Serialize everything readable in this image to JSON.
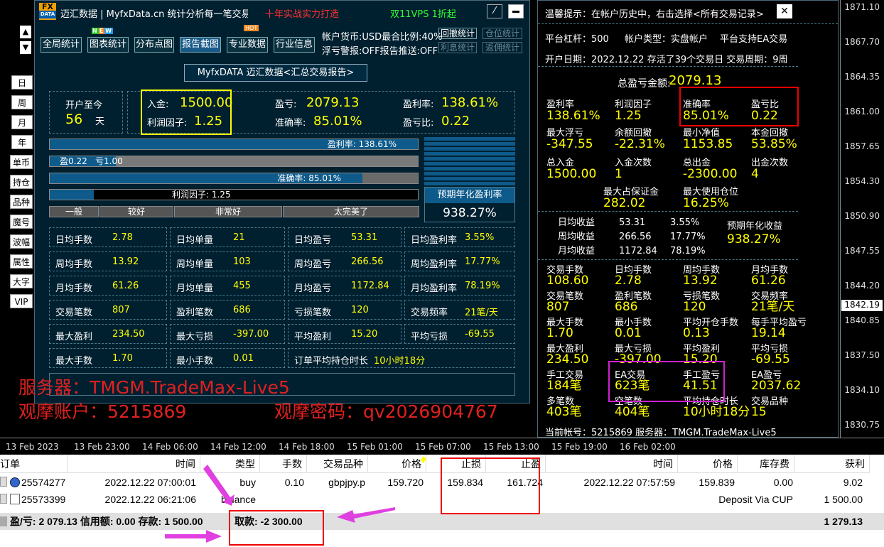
{
  "price_axis": {
    "ticks": [
      "1871.10",
      "1867.70",
      "1864.35",
      "1861.00",
      "1857.65",
      "1854.30",
      "1850.90",
      "1847.55",
      "1844.20",
      "1840.85",
      "1837.50",
      "1834.10",
      "1830.75"
    ],
    "current": "1842.19"
  },
  "time_axis": [
    "13 Feb 2023",
    "13 Feb 23:00",
    "14 Feb 06:00",
    "14 Feb 12:00",
    "14 Feb 18:00",
    "15 Feb 01:00",
    "15 Feb 07:00",
    "15 Feb 13:00",
    "15 Feb 19:00",
    "16 Feb 02:00"
  ],
  "header": {
    "logo_top": "FX",
    "logo_bottom": "DATA",
    "title": "迈汇数据 | MyfxData.cn  统计分析每一笔交易",
    "slogan": "十年实战实力打造",
    "promo": "双11VPS 1折起"
  },
  "toolbar": {
    "buttons": [
      "全局统计",
      "图表统计",
      "分布点图",
      "报告截图",
      "专业数据",
      "行业信息"
    ],
    "info1": "帐户货币:USD最合比例:40%",
    "info2": "浮亏警报:OFF报告推送:OFF",
    "links": [
      "回撤统计",
      "仓位统计",
      "利息统计",
      "返佣统计"
    ],
    "new_badge": "NEW",
    "hot_badge": "HOT"
  },
  "side_buttons": [
    "日",
    "周",
    "月",
    "年",
    "单币",
    "持仓",
    "品种",
    "魔号",
    "波幅",
    "属性",
    "大字",
    "VIP"
  ],
  "report_title": "MyfxDATA 迈汇数据<汇总交易报告>",
  "summary": {
    "since_label": "开户至今",
    "days": "56",
    "days_unit": "天",
    "deposit_label": "入金:",
    "deposit": "1500.00",
    "pf_label": "利润因子:",
    "pf": "1.25",
    "profit_label": "盈亏:",
    "profit": "2079.13",
    "accuracy_label": "准确率:",
    "accuracy": "85.01%",
    "rate_label": "盈利率:",
    "rate": "138.61%",
    "ratio_label": "盈亏比:",
    "ratio": "0.22"
  },
  "bars": {
    "rate": {
      "label": "盈利率: 138.61%",
      "fill": 1.0
    },
    "ratio": {
      "win": "盈0.22",
      "loss": "亏1.00",
      "fill": 0.18
    },
    "accuracy": {
      "label": "准确率:  85.01%",
      "fill": 0.85
    },
    "pf": {
      "label": "利润因子:  1.25",
      "fill": 0.12
    },
    "scale": [
      "一般",
      "较好",
      "非常好",
      "太完美了"
    ]
  },
  "annual": {
    "label": "预期年化盈利率",
    "value": "938.27%"
  },
  "grid": [
    [
      [
        "日均手数",
        "2.78"
      ],
      [
        "日均单量",
        "21"
      ],
      [
        "日均盈亏",
        "53.31"
      ],
      [
        "日均盈利率",
        "3.55%"
      ]
    ],
    [
      [
        "周均手数",
        "13.92"
      ],
      [
        "周均单量",
        "103"
      ],
      [
        "周均盈亏",
        "266.56"
      ],
      [
        "周均盈利率",
        "17.77%"
      ]
    ],
    [
      [
        "月均手数",
        "61.26"
      ],
      [
        "月均单量",
        "455"
      ],
      [
        "月均盈亏",
        "1172.84"
      ],
      [
        "月均盈利率",
        "78.19%"
      ]
    ],
    [
      [
        "交易笔数",
        "807"
      ],
      [
        "盈利笔数",
        "686"
      ],
      [
        "亏损笔数",
        "120"
      ],
      [
        "交易频率",
        "21笔/天"
      ]
    ],
    [
      [
        "最大盈利",
        "234.50"
      ],
      [
        "最大亏损",
        "-397.00"
      ],
      [
        "平均盈利",
        "15.20"
      ],
      [
        "平均亏损",
        "-69.55"
      ]
    ]
  ],
  "last_row": {
    "k1": "最大手数",
    "v1": "1.70",
    "k2": "最小手数",
    "v2": "0.01",
    "k3": "订单平均持仓时长",
    "v3": "10小时18分"
  },
  "overlay": {
    "server": "服务器：TMGM.TradeMax-Live5",
    "account": "观摩账户：5215869",
    "password": "观摩密码：qv2026904767"
  },
  "right": {
    "notice": "温馨提示：在帐户历史中，右击选择<所有交易记录>",
    "close": "✕",
    "leverage": "平台杠杆：500",
    "acct_type": "帐户类型：实盘帐户",
    "ea_support": "平台支持EA交易",
    "open_date": "开户日期：2022.12.22 存活了39个交易日 交易周期：9周",
    "total_label": "总盈亏金额:",
    "total": "2079.13",
    "stats": [
      [
        [
          "盈利率",
          "138.61%"
        ],
        [
          "利润因子",
          "1.25"
        ],
        [
          "准确率",
          "85.01%"
        ],
        [
          "盈亏比",
          "0.22"
        ]
      ],
      [
        [
          "最大浮亏",
          "-347.55"
        ],
        [
          "余额回撤",
          "-22.31%"
        ],
        [
          "最小净值",
          "1153.85"
        ],
        [
          "本金回撤",
          "53.85%"
        ]
      ],
      [
        [
          "总入金",
          "1500.00"
        ],
        [
          "入金次数",
          "1"
        ],
        [
          "总出金",
          "-2300.00"
        ],
        [
          "出金次数",
          "4"
        ]
      ]
    ],
    "margin_row": [
      [
        "最大占保证金",
        "282.02"
      ],
      [
        "最大使用仓位",
        "16.25%"
      ]
    ],
    "income": [
      [
        "日均收益",
        "53.31",
        "3.55%"
      ],
      [
        "周均收益",
        "266.56",
        "17.77%"
      ],
      [
        "月均收益",
        "1172.84",
        "78.19%"
      ]
    ],
    "annual_label": "预期年化收益",
    "annual_value": "938.27%",
    "stats2": [
      [
        [
          "交易手数",
          "108.60"
        ],
        [
          "日均手数",
          "2.78"
        ],
        [
          "周均手数",
          "13.92"
        ],
        [
          "月均手数",
          "61.26"
        ]
      ],
      [
        [
          "交易笔数",
          "807"
        ],
        [
          "盈利笔数",
          "686"
        ],
        [
          "亏损笔数",
          "120"
        ],
        [
          "交易频率",
          "21笔/天"
        ]
      ],
      [
        [
          "最大手数",
          "1.70"
        ],
        [
          "最小手数",
          "0.01"
        ],
        [
          "平均开仓手数",
          "0.13"
        ],
        [
          "每手平均盈亏",
          "19.14"
        ]
      ],
      [
        [
          "最大盈利",
          "234.50"
        ],
        [
          "最大亏损",
          "-397.00"
        ],
        [
          "平均盈利",
          "15.20"
        ],
        [
          "平均亏损",
          "-69.55"
        ]
      ],
      [
        [
          "手工交易",
          "184笔"
        ],
        [
          "EA交易",
          "623笔"
        ],
        [
          "手工盈亏",
          "41.51"
        ],
        [
          "EA盈亏",
          "2037.62"
        ]
      ],
      [
        [
          "多笔数",
          "403笔"
        ],
        [
          "空笔数",
          "404笔"
        ],
        [
          "平均持仓时长",
          "10小时18分"
        ],
        [
          "交易品种",
          "15"
        ]
      ]
    ],
    "footer": "当前帐号：5215869 服务器：TMGM.TradeMax-Live5"
  },
  "table": {
    "headers": [
      "订单",
      "时间",
      "类型",
      "手数",
      "交易品种",
      "价格",
      "止损",
      "止盈",
      "时间",
      "价格",
      "库存费",
      "获利"
    ],
    "sort_icon": "▽",
    "rows": [
      {
        "order": "25574277",
        "time": "2022.12.22 07:00:01",
        "type": "buy",
        "lots": "0.10",
        "symbol": "gbpjpy.p",
        "price": "159.720",
        "sl": "159.834",
        "tp": "161.724",
        "ctime": "2022.12.22 07:57:59",
        "cprice": "159.839",
        "swap": "0.00",
        "profit": "9.02"
      },
      {
        "order": "25573399",
        "time": "2022.12.22 06:21:06",
        "type": "balance",
        "comment": "Deposit Via CUP",
        "profit": "1 500.00"
      }
    ],
    "summary_left": "盈/亏: 2 079.13  信用额: 0.00  存款: 1 500.00",
    "summary_withdraw": "取款: -2 300.00",
    "summary_total": "1 279.13"
  }
}
